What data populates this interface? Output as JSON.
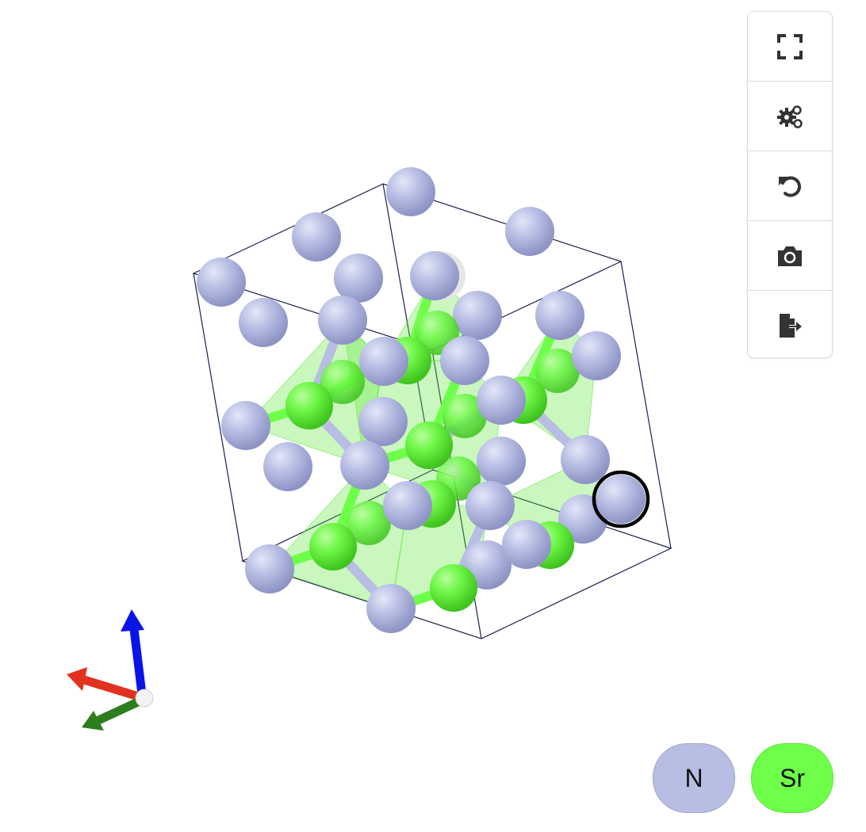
{
  "structure": {
    "elements": [
      {
        "symbol": "N",
        "color": "#b7bde3"
      },
      {
        "symbol": "Sr",
        "color": "#6eff4a"
      }
    ],
    "selected_atom_color": "#000000"
  },
  "toolbar": {
    "buttons": [
      {
        "name": "fullscreen-button",
        "icon": "fullscreen-icon"
      },
      {
        "name": "settings-button",
        "icon": "gears-icon"
      },
      {
        "name": "reset-view-button",
        "icon": "undo-icon"
      },
      {
        "name": "screenshot-button",
        "icon": "camera-icon"
      },
      {
        "name": "export-button",
        "icon": "file-export-icon"
      }
    ]
  },
  "legend": {
    "n_label": "N",
    "sr_label": "Sr",
    "n_color": "#b7bde3",
    "sr_color": "#6eff4a"
  },
  "axes": {
    "x_color": "#e0321e",
    "y_color": "#2e7d1e",
    "z_color": "#0a14e6"
  }
}
